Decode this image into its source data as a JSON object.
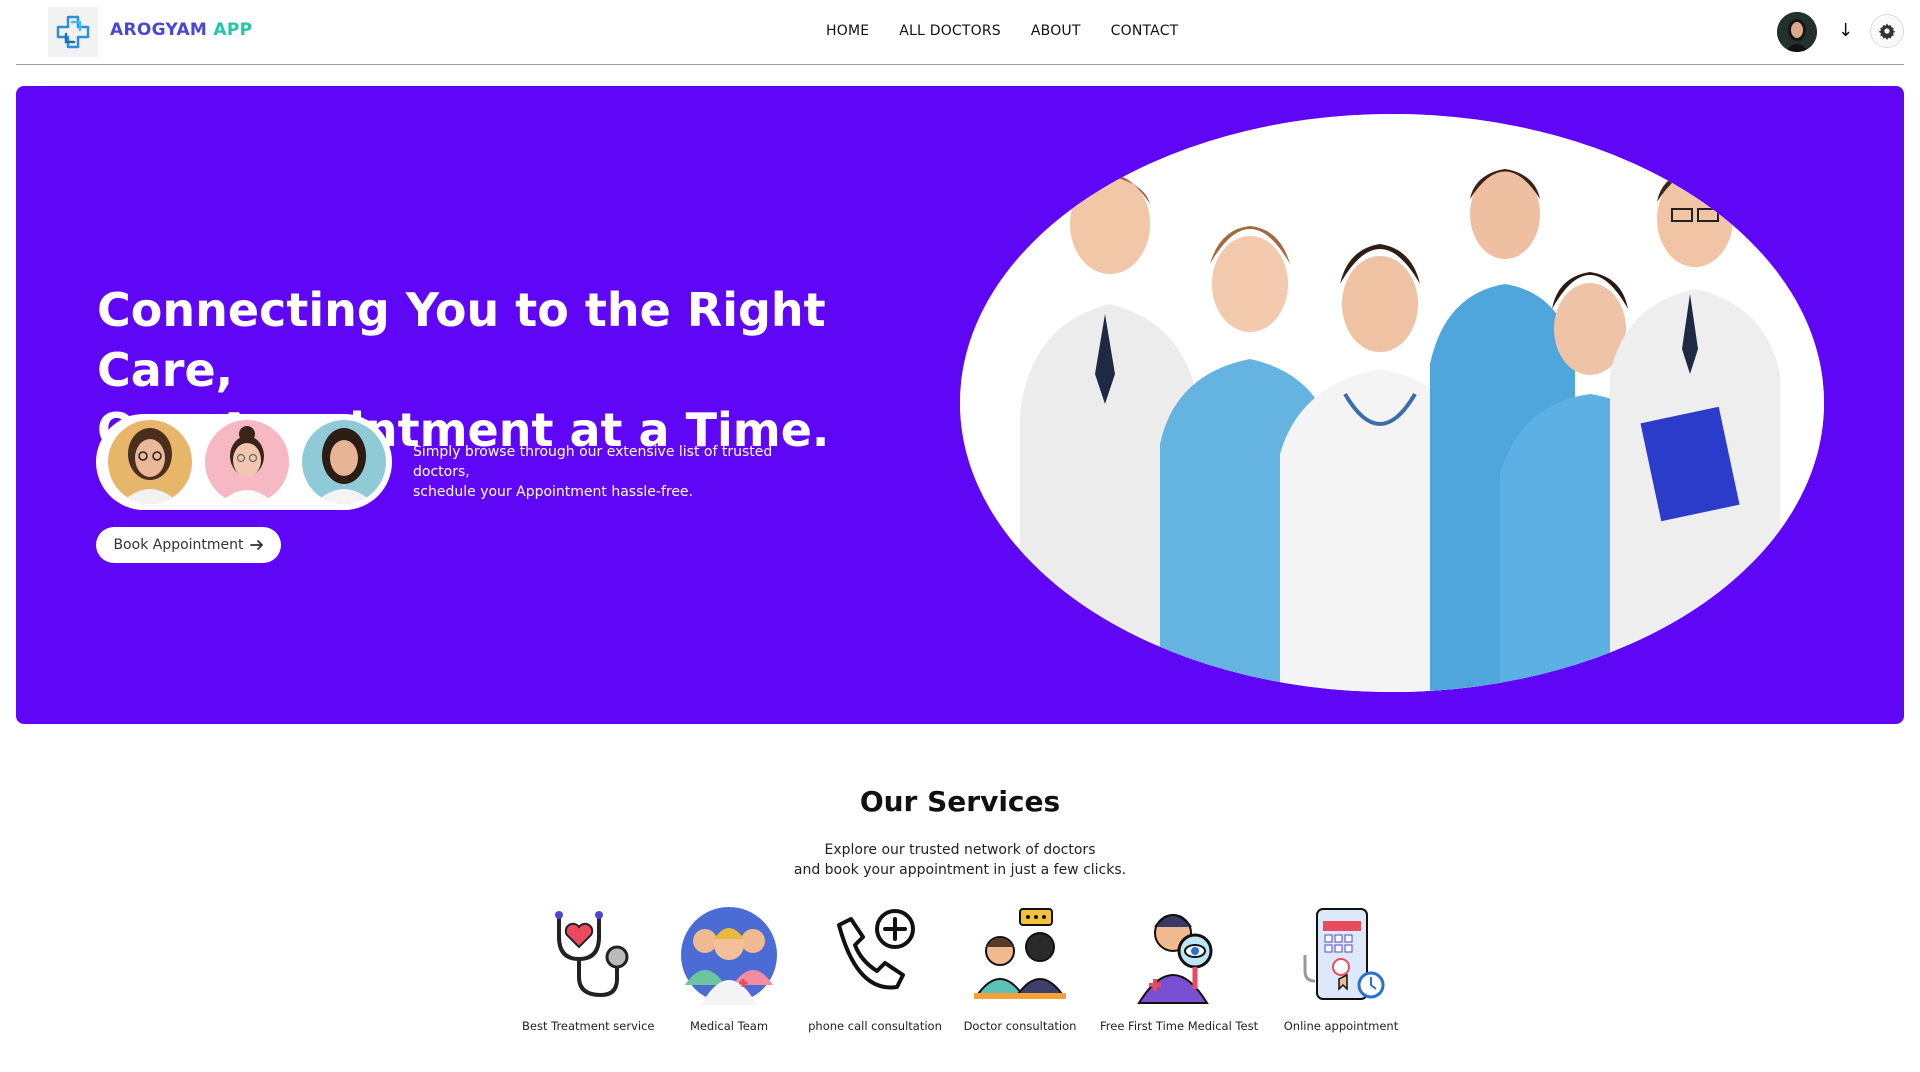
{
  "nav": {
    "brand_part1": "AROGYAM",
    "brand_part2": "APP",
    "links": [
      "HOME",
      "ALL DOCTORS",
      "ABOUT",
      "CONTACT"
    ],
    "profile_arrow": "↓",
    "logo_icon": "medical-cross-logo-icon",
    "settings_icon": "gear-icon"
  },
  "hero": {
    "title_line1": "Connecting You to the Right Care,",
    "title_line2": "One Appointment at a Time.",
    "sub_line1": "Simply browse through our extensive list of trusted doctors,",
    "sub_line2": "schedule your Appointment hassle-free.",
    "cta_label": "Book Appointment",
    "cta_icon": "arrow-right-icon",
    "background": "#5f06f7"
  },
  "services": {
    "title": "Our Services",
    "sub_line1": "Explore our trusted network of doctors",
    "sub_line2": "and book your appointment in just a few clicks.",
    "items": [
      {
        "label": "Best Treatment service",
        "icon": "stethoscope-heart-icon"
      },
      {
        "label": "Medical Team",
        "icon": "medical-team-icon"
      },
      {
        "label": "phone call consultation",
        "icon": "phone-plus-icon"
      },
      {
        "label": "Doctor consultation",
        "icon": "doctor-consultation-icon"
      },
      {
        "label": "Free First Time Medical Test",
        "icon": "medical-test-icon"
      },
      {
        "label": "Online appointment",
        "icon": "online-appointment-icon"
      }
    ]
  },
  "colors": {
    "brand_blue": "#4b46d6",
    "brand_teal": "#20c9a6",
    "hero_purple": "#5f06f7"
  }
}
